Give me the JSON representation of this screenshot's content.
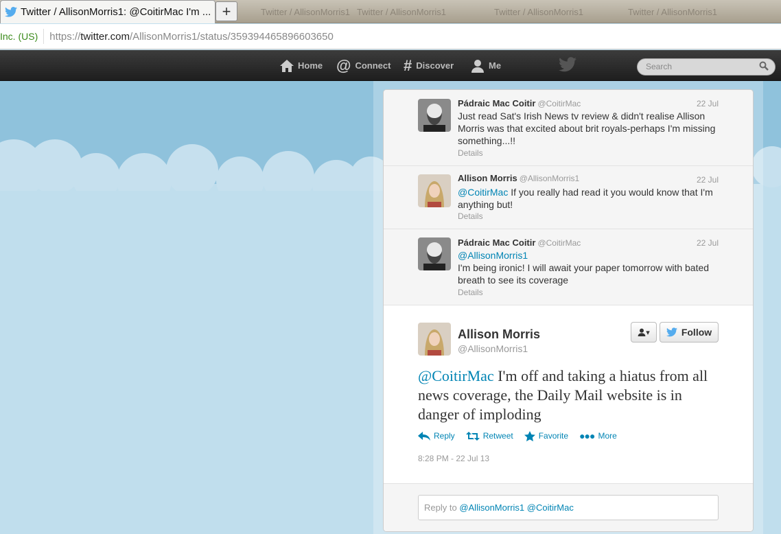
{
  "browser": {
    "active_tab_title": "Twitter / AllisonMorris1: @CoitirMac I'm ...",
    "new_tab_label": "+",
    "background_tabs": [
      "Twitter / AllisonMorris1",
      "Twitter / AllisonMorris1",
      "Twitter / AllisonMorris1",
      "Twitter / AllisonMorris1"
    ],
    "identity": "Inc. (US)",
    "url_scheme": "https://",
    "url_host": "twitter.com",
    "url_path": "/AllisonMorris1/status/359394465896603650"
  },
  "topbar": {
    "home": "Home",
    "connect": "Connect",
    "discover": "Discover",
    "me": "Me",
    "search_placeholder": "Search",
    "brand_color": "#55acee"
  },
  "conversation": [
    {
      "name": "Pádraic Mac Coitir",
      "handle": "@CoitirMac",
      "date": "22 Jul",
      "text": "Just read Sat's Irish News tv review & didn't realise Allison Morris was that excited about brit royals-perhaps I'm missing something...!!",
      "details": "Details"
    },
    {
      "name": "Allison Morris",
      "handle": "@AllisonMorris1",
      "date": "22 Jul",
      "mention": "@CoitirMac",
      "text": " If you really had read it you would know that I'm anything but!",
      "details": "Details"
    },
    {
      "name": "Pádraic Mac Coitir",
      "handle": "@CoitirMac",
      "date": "22 Jul",
      "mention": "@AllisonMorris1",
      "text": " I'm being ironic! I will await your paper tomorrow with bated breath to see its coverage",
      "details": "Details"
    }
  ],
  "permalink": {
    "name": "Allison Morris",
    "handle": "@AllisonMorris1",
    "follow_label": "Follow",
    "mention": "@CoitirMac",
    "text": " I'm off and taking a hiatus from all news coverage, the Daily Mail website is in danger of imploding",
    "reply": "Reply",
    "retweet": "Retweet",
    "favorite": "Favorite",
    "more": "More",
    "timestamp": "8:28 PM - 22 Jul 13"
  },
  "reply_box": {
    "prefix": "Reply to ",
    "mentions": "@AllisonMorris1 @CoitirMac"
  },
  "colors": {
    "background": "#c0deed",
    "link": "#0084b4",
    "topbar": "#2a2a2a"
  }
}
